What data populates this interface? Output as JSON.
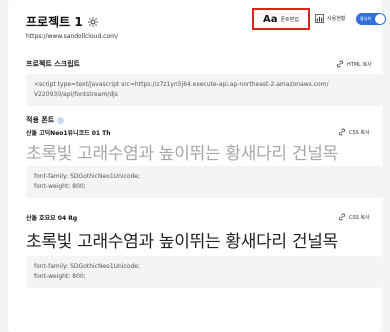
{
  "header": {
    "title": "프로젝트 1",
    "url": "https://www.sandollcloud.com/"
  },
  "toolbar": {
    "font_edit_icon": "Aa",
    "font_edit_label": "폰트편집",
    "usage_label": "사용현황",
    "toggle_label": "활성화",
    "toggle_on": true,
    "highlight_color": "#e0211a",
    "accent_color": "#2f6fe0"
  },
  "script_section": {
    "title": "프로젝트 스크립트",
    "copy_label": "HTML 복사",
    "code_line1": "<script type=text/javascript src=https://z7z1yn5j64.execute-api.ap-northeast-2.amazonaws.com/",
    "code_line2": "V220930/api/fontstream/djs"
  },
  "fonts_section": {
    "title": "적용 폰트",
    "fonts": [
      {
        "name": "산돌 고딕Neo1유니코드 01 Th",
        "copy_label": "CSS 복사",
        "sample": "초록빛 고래수염과 높이뛰는 황새다리 건널목",
        "css_line1": "font-family: SDGothicNeo1Unicode;",
        "css_line2": "font-weight: 800;"
      },
      {
        "name": "산돌 호요요 04 Rg",
        "copy_label": "CSS 복사",
        "sample": "초록빛 고래수염과 높이뛰는 황새다리 건널목",
        "css_line1": "font-family: SDGothicNeo1Unicode;",
        "css_line2": "font-weight: 800;"
      }
    ]
  }
}
